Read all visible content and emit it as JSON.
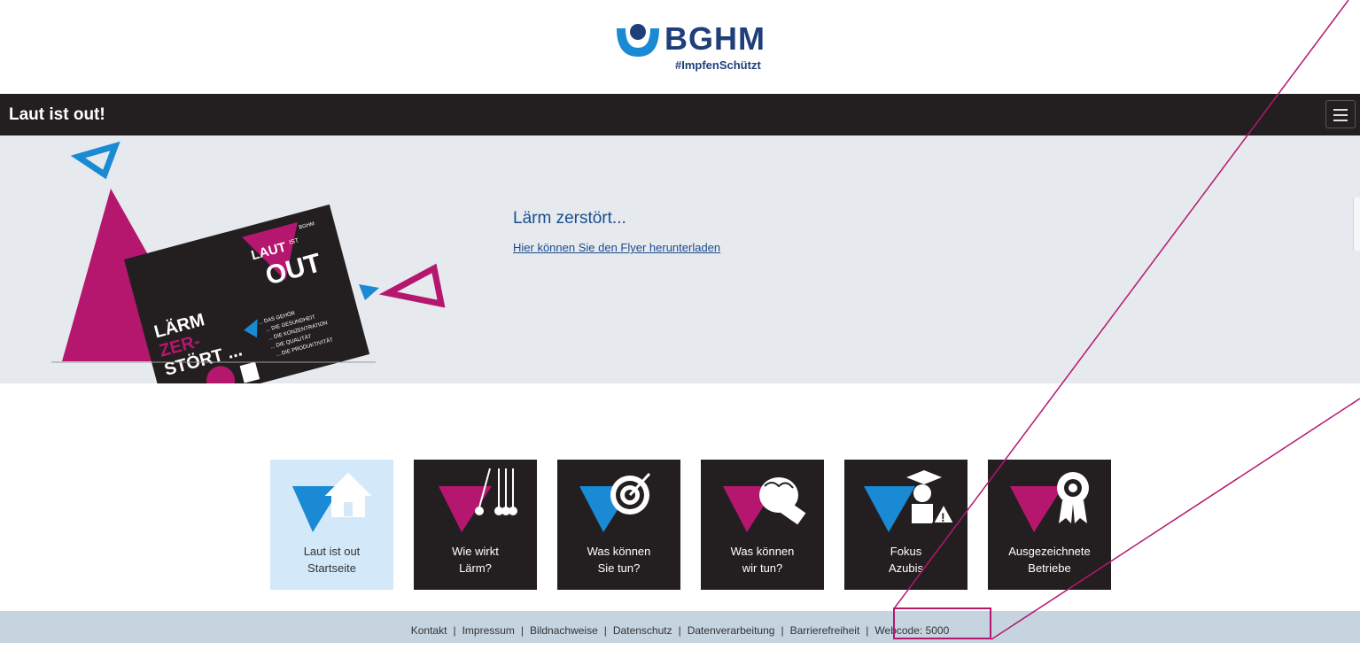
{
  "header": {
    "logo_text": "BGHM",
    "logo_tagline": "#ImpfenSchützt"
  },
  "topbar": {
    "title": "Laut ist out!",
    "menu_icon": "hamburger-menu-icon"
  },
  "hero": {
    "heading": "Lärm zerstört...",
    "link_text": "Hier können Sie den Flyer herunterladen",
    "flyer": {
      "brand": "BGHM",
      "title_top": "LAUT",
      "title_small": "IST",
      "title_bottom": "OUT",
      "slogan_line1": "LÄRM",
      "slogan_line2": "ZER-",
      "slogan_line3": "STÖRT ...",
      "list": [
        "... DAS GEHÖR",
        "... DIE GESUNDHEIT",
        "... DIE KONZENTRATION",
        "... DIE QUALITÄT",
        "... DIE PRODUKTIVITÄT"
      ]
    }
  },
  "tiles": [
    {
      "label": "Laut ist out\nStartseite",
      "icon": "house-icon",
      "active": true
    },
    {
      "label": "Wie wirkt\nLärm?",
      "icon": "newtons-cradle-icon",
      "active": false
    },
    {
      "label": "Was können\nSie tun?",
      "icon": "target-icon",
      "active": false
    },
    {
      "label": "Was können\nwir tun?",
      "icon": "fist-icon",
      "active": false
    },
    {
      "label": "Fokus\nAzubis",
      "icon": "graduate-warning-icon",
      "active": false
    },
    {
      "label": "Ausgezeichnete\nBetriebe",
      "icon": "award-badge-icon",
      "active": false
    }
  ],
  "footer": {
    "links": [
      "Kontakt",
      "Impressum",
      "Bildnachweise",
      "Datenschutz",
      "Datenverarbeitung",
      "Barrierefreiheit"
    ],
    "separator": "|",
    "webcode": "Webcode: 5000"
  },
  "colors": {
    "magenta": "#b5176f",
    "blue": "#1a8ad4",
    "dark": "#231f20",
    "navy": "#1f3f7a",
    "link": "#1a4d8f"
  }
}
